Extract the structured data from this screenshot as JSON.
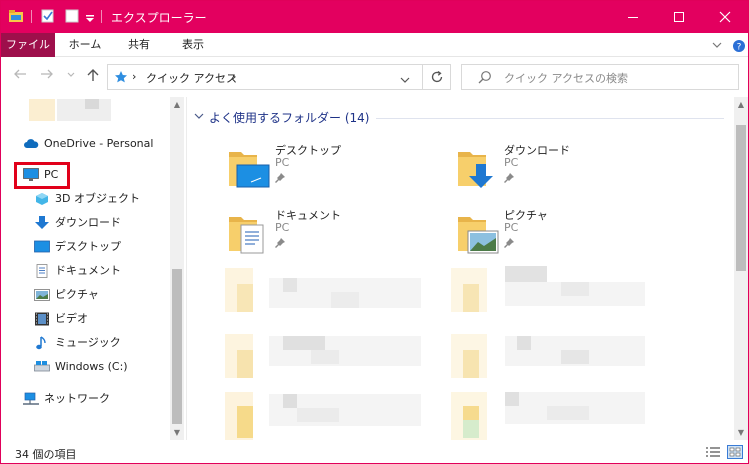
{
  "window": {
    "title": "エクスプローラー",
    "accent_color": "#e3005f",
    "file_tab_color": "#9e0f4b",
    "controls": [
      "minimize-icon",
      "maximize-icon",
      "close-icon"
    ]
  },
  "ribbon": {
    "tabs": [
      "ファイル",
      "ホーム",
      "共有",
      "表示"
    ]
  },
  "address": {
    "path": "クイック アクセス",
    "search_placeholder": "クイック アクセスの検索"
  },
  "nav": {
    "items": [
      {
        "label": "OneDrive - Personal",
        "icon": "cloud-icon"
      },
      {
        "label": "PC",
        "icon": "computer-icon"
      },
      {
        "label": "3D オブジェクト",
        "icon": "3d-objects-icon"
      },
      {
        "label": "ダウンロード",
        "icon": "download-icon"
      },
      {
        "label": "デスクトップ",
        "icon": "desktop-icon"
      },
      {
        "label": "ドキュメント",
        "icon": "document-icon"
      },
      {
        "label": "ピクチャ",
        "icon": "picture-icon"
      },
      {
        "label": "ビデオ",
        "icon": "video-icon"
      },
      {
        "label": "ミュージック",
        "icon": "music-icon"
      },
      {
        "label": "Windows (C:)",
        "icon": "drive-icon"
      },
      {
        "label": "ネットワーク",
        "icon": "network-icon"
      }
    ],
    "highlight_color": "#e1001a"
  },
  "content": {
    "group_title": "よく使用するフォルダー (14)",
    "tiles": [
      {
        "name": "デスクトップ",
        "location": "PC",
        "icon": "desktop-folder-icon"
      },
      {
        "name": "ダウンロード",
        "location": "PC",
        "icon": "download-folder-icon"
      },
      {
        "name": "ドキュメント",
        "location": "PC",
        "icon": "documents-folder-icon"
      },
      {
        "name": "ピクチャ",
        "location": "PC",
        "icon": "pictures-folder-icon"
      }
    ]
  },
  "status": {
    "item_count": "34 個の項目"
  }
}
